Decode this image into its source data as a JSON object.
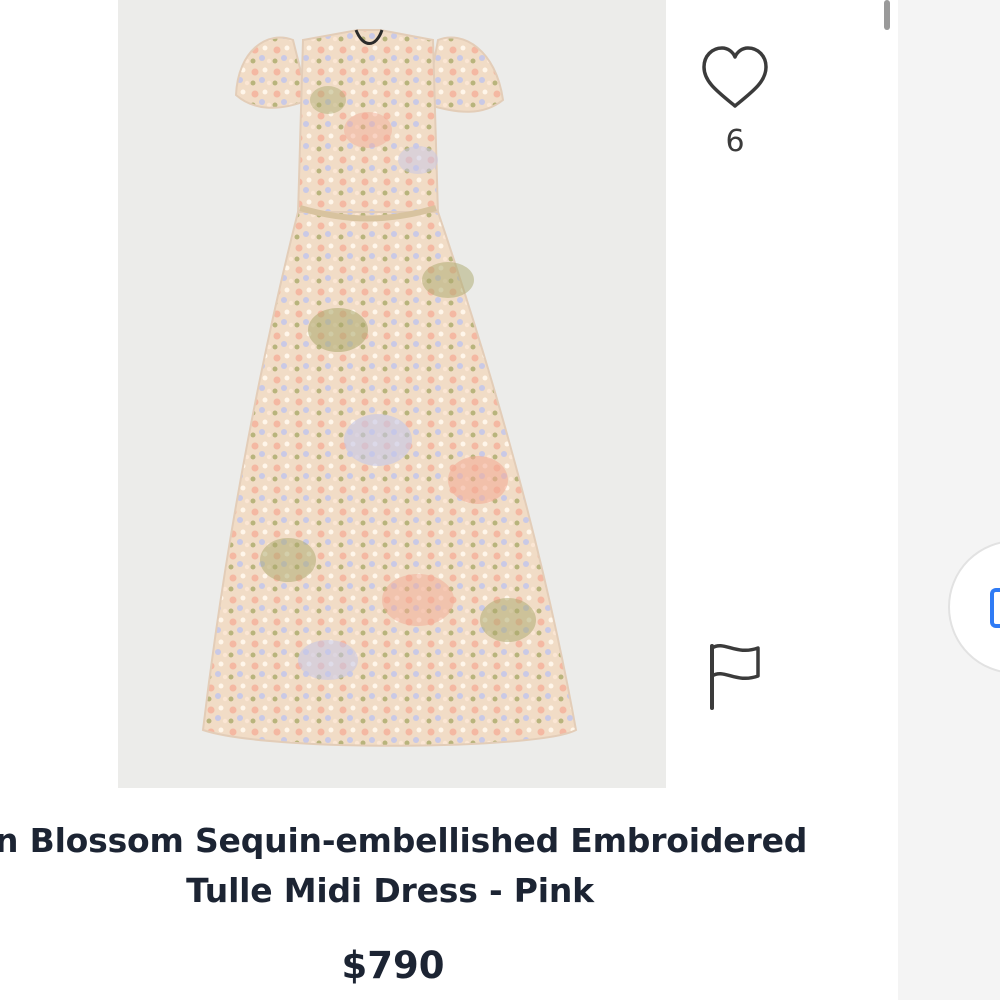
{
  "product": {
    "title_line1": "lin Blossom Sequin-embellished Embroidered",
    "title_line2": "Tulle Midi Dress - Pink",
    "price": "$790",
    "image_alt": "dress-photo"
  },
  "actions": {
    "like_icon": "heart-outline-icon",
    "like_count": "6",
    "report_icon": "flag-outline-icon"
  },
  "colors": {
    "text": "#1c2433",
    "muted_text": "#3b3b3b",
    "photo_bg": "#ececea",
    "dress_base": "#f3dfcc",
    "accent_blue": "#2f7bf5"
  }
}
